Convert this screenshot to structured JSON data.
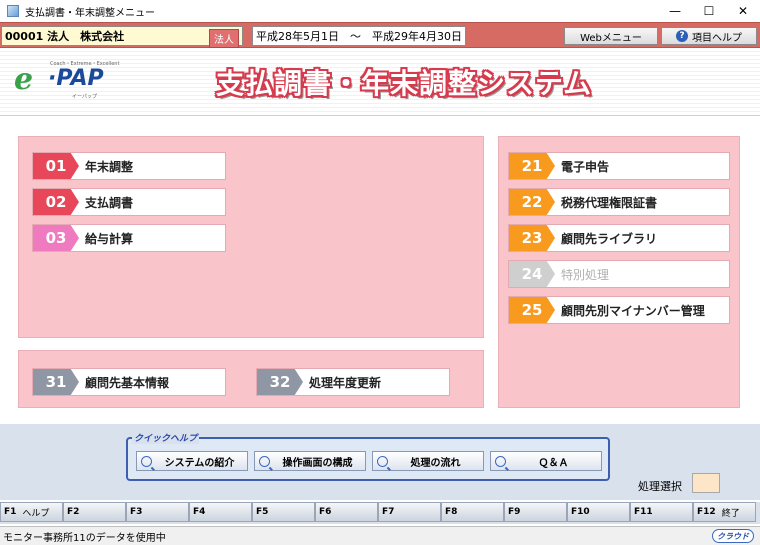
{
  "window": {
    "title": "支払調書・年末調整メニュー",
    "min": "—",
    "max": "☐",
    "close": "✕"
  },
  "info": {
    "company": "00001 法人　株式会社",
    "company_badge": "法人",
    "period": "平成28年5月1日　～　平成29年4月30日",
    "webmenu": "Webメニュー",
    "help": "項目ヘルプ",
    "help_icon": "?"
  },
  "banner": {
    "logo_main": "e·PAP",
    "logo_e": "e",
    "logo_pap": "·PAP",
    "logo_tag": "Coach・Extreme・Excellent",
    "logo_tag2": "イーパップ",
    "title": "支払調書・年末調整システム"
  },
  "colors": {
    "red": "#e8475a",
    "pink": "#f07ac0",
    "orange": "#f79a1e",
    "grey": "#8e97a3",
    "disabled": "#cfcfcf"
  },
  "menu_left": [
    {
      "num": "01",
      "label": "年末調整",
      "color": "#e8475a"
    },
    {
      "num": "02",
      "label": "支払調書",
      "color": "#e8475a"
    },
    {
      "num": "03",
      "label": "給与計算",
      "color": "#f07ac0"
    }
  ],
  "menu_right": [
    {
      "num": "21",
      "label": "電子申告",
      "color": "#f79a1e"
    },
    {
      "num": "22",
      "label": "税務代理権限証書",
      "color": "#f79a1e"
    },
    {
      "num": "23",
      "label": "顧問先ライブラリ",
      "color": "#f79a1e"
    },
    {
      "num": "24",
      "label": "特別処理",
      "color": "#cfcfcf",
      "disabled": true
    },
    {
      "num": "25",
      "label": "顧問先別マイナンバー管理",
      "color": "#f79a1e"
    }
  ],
  "menu_bottom": [
    {
      "num": "31",
      "label": "顧問先基本情報",
      "color": "#8e97a3"
    },
    {
      "num": "32",
      "label": "処理年度更新",
      "color": "#8e97a3"
    }
  ],
  "quickhelp": {
    "title": "クイックヘルプ",
    "buttons": [
      "システムの紹介",
      "操作画面の構成",
      "処理の流れ",
      "Ｑ＆Ａ"
    ]
  },
  "select": {
    "label": "処理選択",
    "value": ""
  },
  "fkeys": [
    {
      "k": "F1",
      "label": "ヘルプ"
    },
    {
      "k": "F2",
      "label": ""
    },
    {
      "k": "F3",
      "label": ""
    },
    {
      "k": "F4",
      "label": ""
    },
    {
      "k": "F5",
      "label": ""
    },
    {
      "k": "F6",
      "label": ""
    },
    {
      "k": "F7",
      "label": ""
    },
    {
      "k": "F8",
      "label": ""
    },
    {
      "k": "F9",
      "label": ""
    },
    {
      "k": "F10",
      "label": ""
    },
    {
      "k": "F11",
      "label": ""
    },
    {
      "k": "F12",
      "label": "終了"
    }
  ],
  "status": {
    "text": "モニター事務所11のデータを使用中",
    "cloud": "クラウド"
  }
}
